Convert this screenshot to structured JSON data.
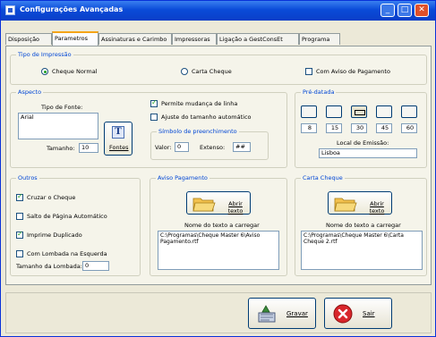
{
  "window": {
    "title": "Configurações Avançadas",
    "controls": {
      "minimize": "_",
      "maximize": "□",
      "close": "✕"
    }
  },
  "tabs": [
    "Disposição",
    "Parametros",
    "Assinaturas e Carimbo",
    "Impressoras",
    "Ligação a GestConsEt",
    "Programa"
  ],
  "active_tab": "Parametros",
  "tipo_impressao": {
    "title": "Tipo de Impressão",
    "options": [
      {
        "label": "Cheque Normal",
        "selected": true
      },
      {
        "label": "Carta Cheque",
        "selected": false
      }
    ],
    "aviso": {
      "label": "Com Aviso de Pagamento",
      "checked": false
    }
  },
  "aspecto": {
    "title": "Aspecto",
    "font_label": "Tipo de Fonte:",
    "font_value": "Arial",
    "size_label": "Tamanho:",
    "size_value": "10",
    "fonts_button": "Fontes",
    "fonts_icon": "T",
    "permite": {
      "label": "Permite mudança de linha",
      "checked": true
    },
    "ajuste": {
      "label": "Ajuste do tamanho automático",
      "checked": false
    },
    "simbolo": {
      "title": "Símbolo de preenchimento",
      "valor_label": "Valor:",
      "valor_value": "0",
      "extenso_label": "Extenso:",
      "extenso_value": "##"
    }
  },
  "pre_datada": {
    "title": "Pré-datada",
    "values": [
      "8",
      "15",
      "30",
      "45",
      "60"
    ],
    "local_label": "Local de Emissão:",
    "local_value": "Lisboa"
  },
  "outros": {
    "title": "Outros",
    "items": [
      {
        "label": "Cruzar o Cheque",
        "checked": true
      },
      {
        "label": "Salto de Página Automático",
        "checked": false
      },
      {
        "label": "Imprime Duplicado",
        "checked": true
      },
      {
        "label": "Com Lombada na Esquerda",
        "checked": false
      }
    ],
    "lombada_label": "Tamanho da Lombada:",
    "lombada_value": "0"
  },
  "aviso_pagamento": {
    "title": "Aviso Pagamento",
    "button": "Abrir texto",
    "file_label": "Nome do texto a carregar",
    "file_value": "C:\\Programas\\Cheque Master 6\\Aviso Pagamento.rtf"
  },
  "carta_cheque": {
    "title": "Carta Cheque",
    "button": "Abrir texto",
    "file_label": "Nome do texto a carregar",
    "file_value": "C:\\Programas\\Cheque Master 6\\Carta Cheque 2.rtf"
  },
  "footer": {
    "save": "Gravar",
    "exit": "Sair"
  }
}
